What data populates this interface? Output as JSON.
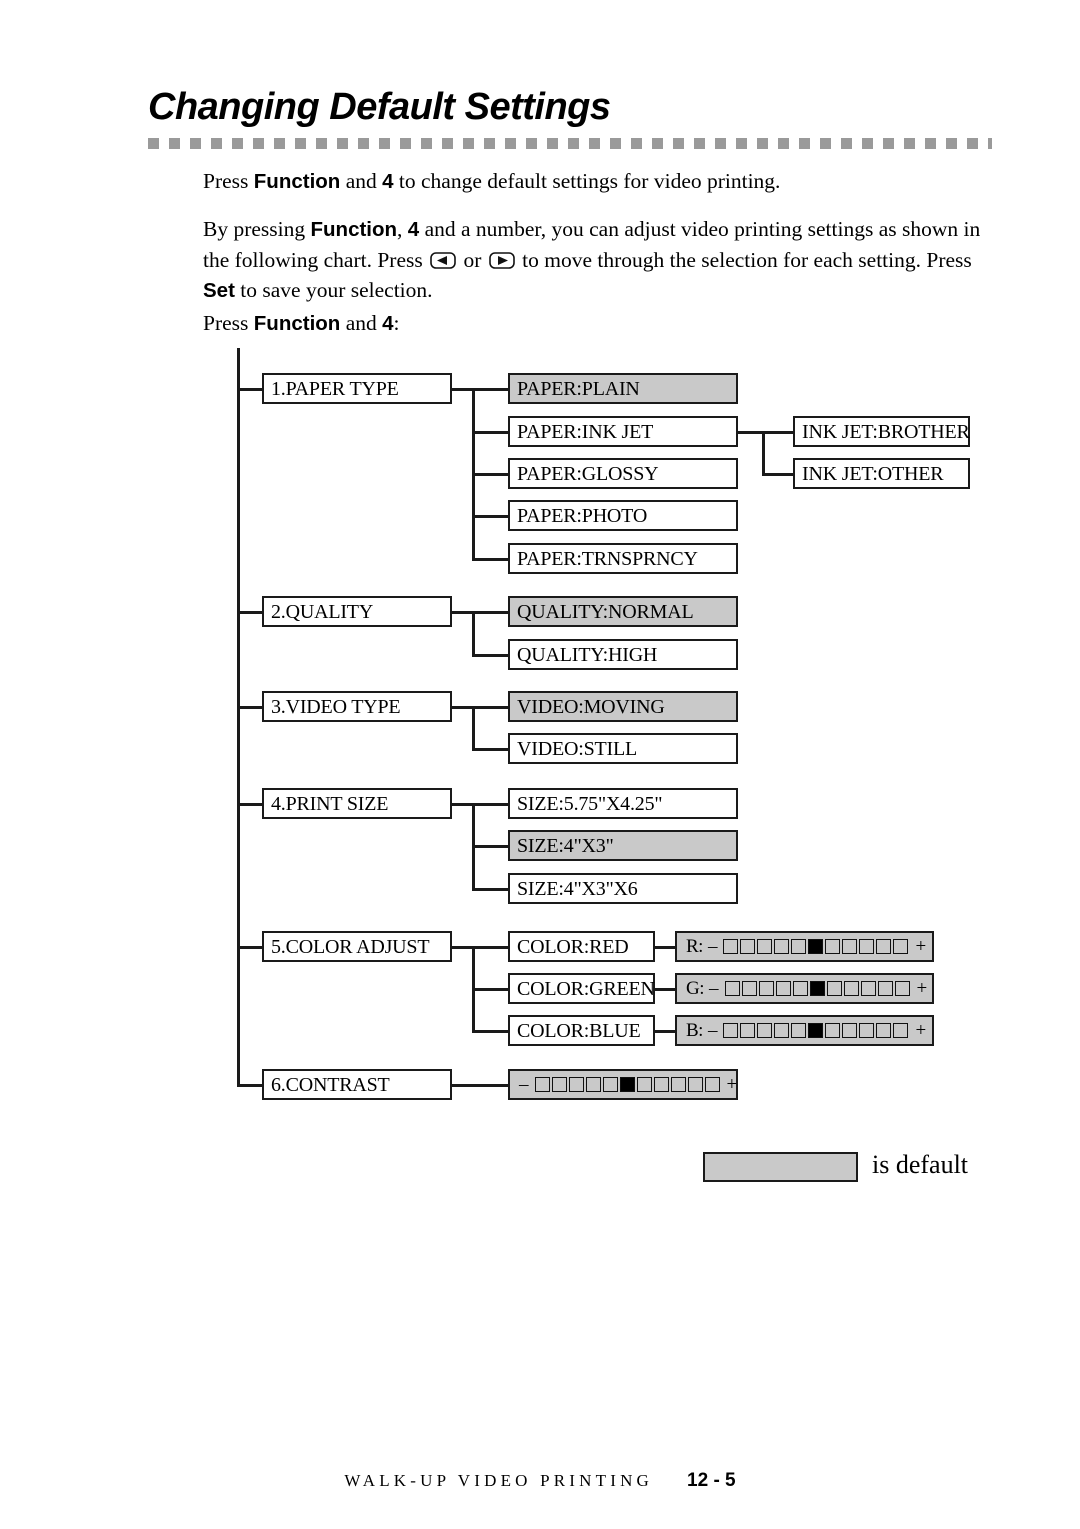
{
  "header": {
    "title": "Changing Default Settings"
  },
  "body": {
    "para1": {
      "seg1": "Press ",
      "bold1": "Function",
      "seg2": " and ",
      "bold2": "4",
      "seg3": " to change default settings for video printing."
    },
    "para2": {
      "seg1": "By pressing ",
      "bold1": "Function",
      "seg2": ", ",
      "bold2": "4",
      "seg3": " and a number, you can adjust video printing settings as shown in the following chart. Press ",
      "seg4": " or ",
      "seg5": " to move through the selection for each setting. Press ",
      "bold3": "Set",
      "seg6": " to save your selection."
    },
    "para3": {
      "seg1": "Press ",
      "bold1": "Function",
      "seg2": " and ",
      "bold2": "4",
      "seg3": ":"
    }
  },
  "chart": {
    "menu": [
      {
        "label": "1.PAPER TYPE",
        "options": [
          {
            "label": "PAPER:PLAIN",
            "is_default": true
          },
          {
            "label": "PAPER:INK JET",
            "is_default": false,
            "sub": [
              {
                "label": "INK JET:BROTHER",
                "is_default": false
              },
              {
                "label": "INK JET:OTHER",
                "is_default": false
              }
            ]
          },
          {
            "label": "PAPER:GLOSSY",
            "is_default": false
          },
          {
            "label": "PAPER:PHOTO",
            "is_default": false
          },
          {
            "label": "PAPER:TRNSPRNCY",
            "is_default": false
          }
        ]
      },
      {
        "label": "2.QUALITY",
        "options": [
          {
            "label": "QUALITY:NORMAL",
            "is_default": true
          },
          {
            "label": "QUALITY:HIGH",
            "is_default": false
          }
        ]
      },
      {
        "label": "3.VIDEO TYPE",
        "options": [
          {
            "label": "VIDEO:MOVING",
            "is_default": true
          },
          {
            "label": "VIDEO:STILL",
            "is_default": false
          }
        ]
      },
      {
        "label": "4.PRINT SIZE",
        "options": [
          {
            "label": "SIZE:5.75\"X4.25\"",
            "is_default": false
          },
          {
            "label": "SIZE:4\"X3\"",
            "is_default": true
          },
          {
            "label": "SIZE:4\"X3\"X6",
            "is_default": false
          }
        ]
      },
      {
        "label": "5.COLOR ADJUST",
        "options": [
          {
            "label": "COLOR:RED",
            "is_default": false
          },
          {
            "label": "COLOR:GREEN",
            "is_default": false
          },
          {
            "label": "COLOR:BLUE",
            "is_default": false
          }
        ]
      },
      {
        "label": "6.CONTRAST",
        "options": []
      }
    ],
    "sliders": [
      {
        "name": "red-level",
        "prefix": "R:",
        "minus": "–",
        "plus": "+",
        "cells": 11,
        "filled_index": 6
      },
      {
        "name": "green-level",
        "prefix": "G:",
        "minus": "–",
        "plus": "+",
        "cells": 11,
        "filled_index": 6
      },
      {
        "name": "blue-level",
        "prefix": "B:",
        "minus": "–",
        "plus": "+",
        "cells": 11,
        "filled_index": 6
      },
      {
        "name": "contrast-level",
        "prefix": "",
        "minus": "–",
        "plus": "+",
        "cells": 11,
        "filled_index": 6
      }
    ],
    "legend": {
      "text": "is default"
    }
  },
  "footer": {
    "title": "WALK-UP VIDEO PRINTING",
    "page": "12 - 5"
  },
  "colors": {
    "default_fill": "#c9c9c9",
    "rule": "#9a9a9a",
    "line": "#1a1a1a"
  }
}
